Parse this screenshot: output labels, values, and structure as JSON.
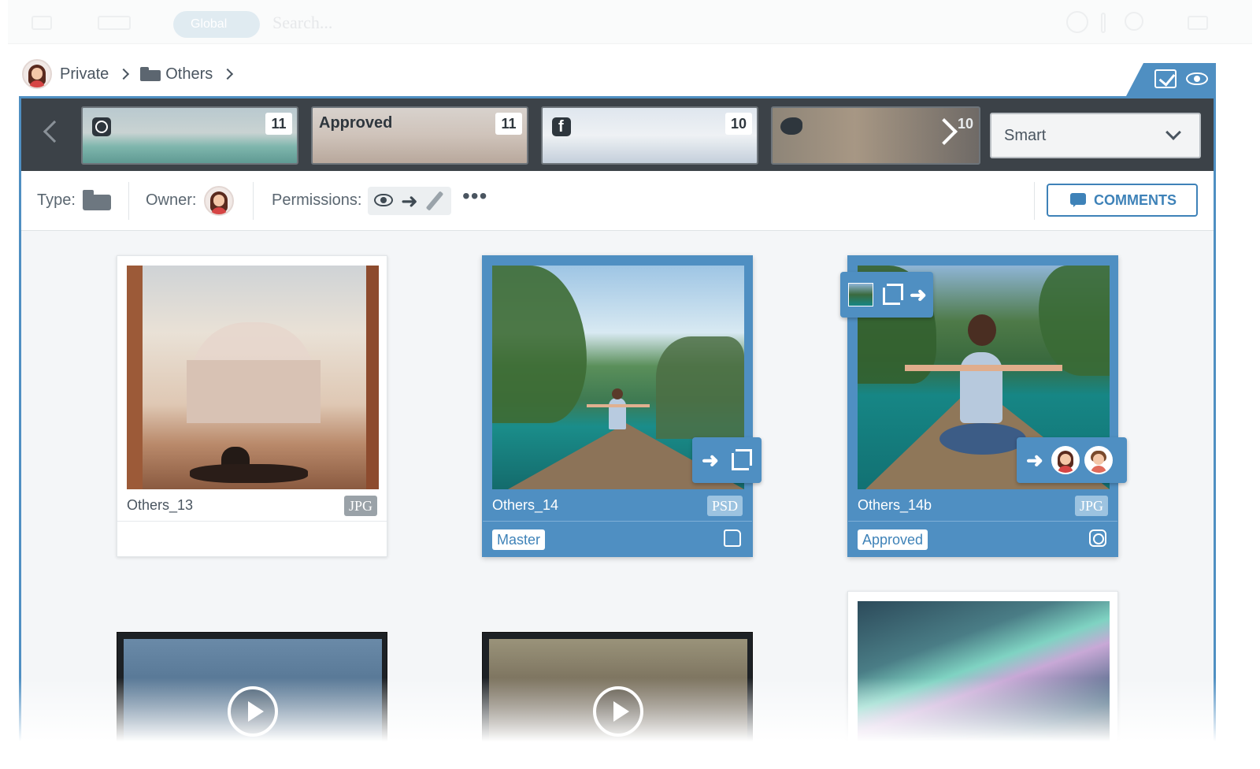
{
  "topbar": {
    "scope_label": "Global",
    "search_placeholder": "Search..."
  },
  "breadcrumb": {
    "root": "Private",
    "folder": "Others"
  },
  "channels": [
    {
      "name": "",
      "icon": "instagram-icon",
      "count": "11"
    },
    {
      "name": "Approved",
      "icon": "",
      "count": "11"
    },
    {
      "name": "",
      "icon": "facebook-icon",
      "count": "10"
    },
    {
      "name": "",
      "icon": "twitter-icon",
      "count": "10"
    }
  ],
  "sort_select": {
    "value": "Smart"
  },
  "filters": {
    "type_label": "Type:",
    "owner_label": "Owner:",
    "permissions_label": "Permissions:",
    "more": "•••",
    "comments_button": "COMMENTS"
  },
  "gallery": [
    {
      "name": "Others_13",
      "type": "JPG",
      "tag": "",
      "selected": false
    },
    {
      "name": "Others_14",
      "type": "PSD",
      "tag": "Master",
      "selected": true
    },
    {
      "name": "Others_14b",
      "type": "JPG",
      "tag": "Approved",
      "selected": true
    }
  ],
  "colors": {
    "accent": "#4f8fc2",
    "strip": "#3c4248",
    "panel_bg": "#f4f6f8",
    "text": "#4a5560"
  }
}
